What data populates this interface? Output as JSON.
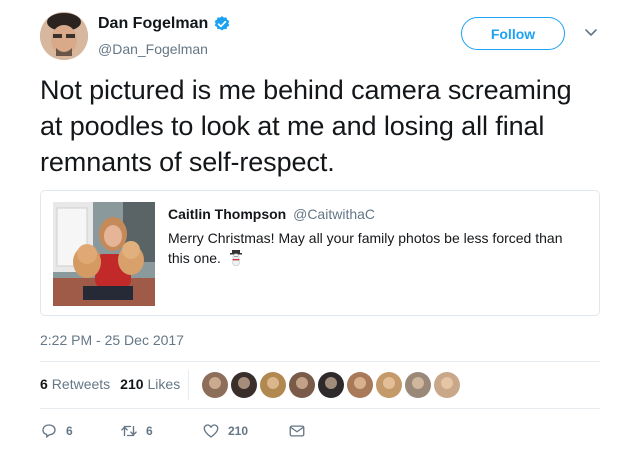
{
  "author": {
    "name": "Dan Fogelman",
    "handle": "@Dan_Fogelman",
    "verified": true
  },
  "follow_label": "Follow",
  "tweet_text": "Not pictured is me behind camera screaming at poodles to look at me and losing all final remnants of self-respect.",
  "quoted_tweet": {
    "name": "Caitlin Thompson",
    "handle": "@CaitwithaC",
    "text": "Merry Christmas! May all your family photos be less forced than this one."
  },
  "timestamp": "2:22 PM - 25 Dec 2017",
  "stats": {
    "retweets_count": "6",
    "retweets_label": "Retweets",
    "likes_count": "210",
    "likes_label": "Likes"
  },
  "liker_avatar_colors": [
    "#8c6e5a",
    "#3a2e2a",
    "#b08850",
    "#7a5a48",
    "#2e2a2c",
    "#a87a5a",
    "#c49a6a",
    "#9a8878",
    "#c8a888"
  ],
  "actions": {
    "reply_count": "6",
    "retweet_count": "6",
    "like_count": "210"
  },
  "colors": {
    "accent": "#1da1f2",
    "secondary_text": "#657786"
  }
}
